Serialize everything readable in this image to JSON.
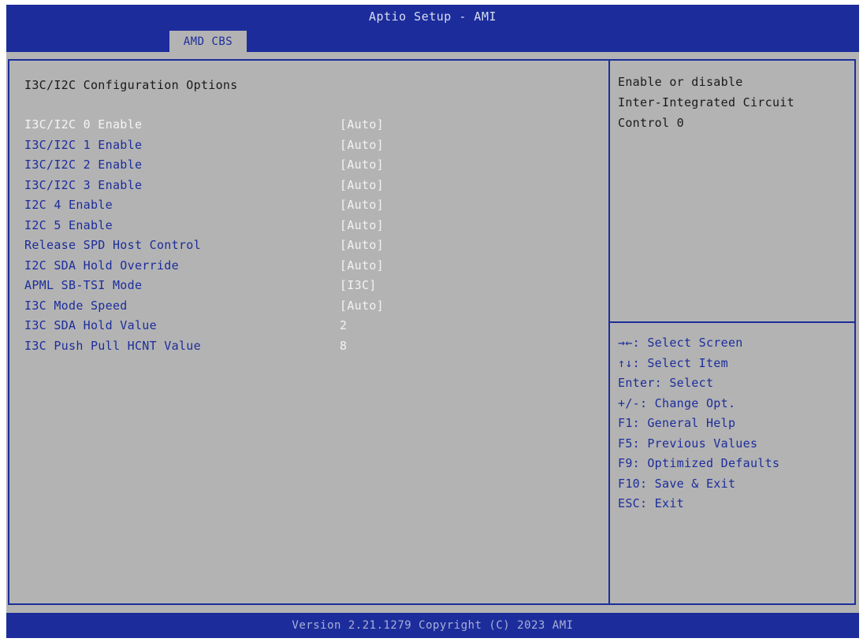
{
  "header": {
    "title": "Aptio Setup - AMI",
    "tab": "AMD CBS"
  },
  "main": {
    "title": "I3C/I2C Configuration Options",
    "settings": [
      {
        "label": "I3C/I2C 0 Enable",
        "value": "[Auto]"
      },
      {
        "label": "I3C/I2C 1 Enable",
        "value": "[Auto]"
      },
      {
        "label": "I3C/I2C 2 Enable",
        "value": "[Auto]"
      },
      {
        "label": "I3C/I2C 3 Enable",
        "value": "[Auto]"
      },
      {
        "label": "I2C 4 Enable",
        "value": "[Auto]"
      },
      {
        "label": "I2C 5 Enable",
        "value": "[Auto]"
      },
      {
        "label": "Release SPD Host Control",
        "value": "[Auto]"
      },
      {
        "label": "I2C SDA Hold Override",
        "value": "[Auto]"
      },
      {
        "label": "APML SB-TSI Mode",
        "value": "[I3C]"
      },
      {
        "label": "I3C Mode Speed",
        "value": "[Auto]"
      },
      {
        "label": "I3C SDA Hold Value",
        "value": "2"
      },
      {
        "label": "I3C Push Pull HCNT Value",
        "value": "8"
      }
    ]
  },
  "help": {
    "lines": [
      "Enable or disable",
      "Inter-Integrated Circuit",
      "Control 0"
    ]
  },
  "keys": [
    "→←: Select Screen",
    "↑↓: Select Item",
    "Enter: Select",
    "+/-: Change Opt.",
    "F1: General Help",
    "F5: Previous Values",
    "F9: Optimized Defaults",
    "F10: Save & Exit",
    "ESC: Exit"
  ],
  "footer": {
    "text": "Version 2.21.1279 Copyright (C) 2023 AMI"
  },
  "colors": {
    "accent": "#1c2d9b",
    "background": "#b3b3b3",
    "selected_text": "#f5f5f5"
  }
}
